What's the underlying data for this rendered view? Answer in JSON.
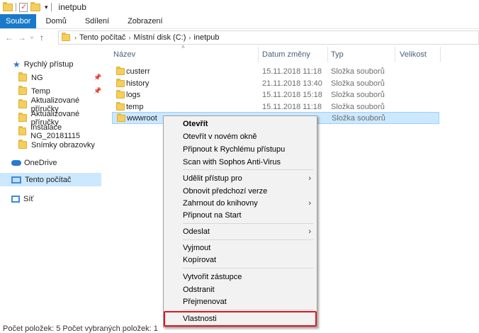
{
  "title": "inetpub",
  "ribbon": {
    "tabs": [
      "Soubor",
      "Domů",
      "Sdílení",
      "Zobrazení"
    ]
  },
  "breadcrumbs": [
    "Tento počítač",
    "Místní disk (C:)",
    "inetpub"
  ],
  "sidebar": {
    "quick_access": "Rychlý přístup",
    "items": [
      "NG",
      "Temp",
      "Aktualizované příručky",
      "Aktualizované příručky",
      "Instalace NG_20181115",
      "Snímky obrazovky"
    ],
    "onedrive": "OneDrive",
    "this_pc": "Tento počítač",
    "network": "Síť"
  },
  "columns": {
    "name": "Název",
    "date": "Datum změny",
    "type": "Typ",
    "size": "Velikost"
  },
  "files": [
    {
      "name": "custerr",
      "date": "15.11.2018 11:18",
      "type": "Složka souborů"
    },
    {
      "name": "history",
      "date": "21.11.2018 13:40",
      "type": "Složka souborů"
    },
    {
      "name": "logs",
      "date": "15.11.2018 15:18",
      "type": "Složka souborů"
    },
    {
      "name": "temp",
      "date": "15.11.2018 11:18",
      "type": "Složka souborů"
    },
    {
      "name": "wwwroot",
      "date": "",
      "type": "Složka souborů"
    }
  ],
  "context_menu": {
    "open": "Otevřít",
    "open_new_window": "Otevřít v novém okně",
    "pin_quick": "Připnout k Rychlému přístupu",
    "scan": "Scan with Sophos Anti-Virus",
    "grant_access": "Udělit přístup pro",
    "restore": "Obnovit předchozí verze",
    "include_library": "Zahrnout do knihovny",
    "pin_start": "Připnout na Start",
    "send_to": "Odeslat",
    "cut": "Vyjmout",
    "copy": "Kopírovat",
    "create_shortcut": "Vytvořit zástupce",
    "delete": "Odstranit",
    "rename": "Přejmenovat",
    "properties": "Vlastnosti"
  },
  "status": "Počet položek: 5   Počet vybraných položek: 1"
}
